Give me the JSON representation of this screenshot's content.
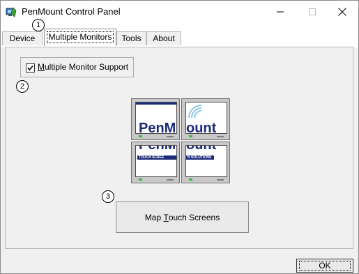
{
  "window": {
    "title": "PenMount Control Panel"
  },
  "tabs": [
    {
      "label": "Device",
      "selected": false
    },
    {
      "label": "Multiple Monitors",
      "selected": true
    },
    {
      "label": "Tools",
      "selected": false
    },
    {
      "label": "About",
      "selected": false
    }
  ],
  "callouts": {
    "one": "1",
    "two": "2",
    "three": "3"
  },
  "multi_monitor": {
    "checkbox_underlined_char": "M",
    "checkbox_label_rest": "ultiple Monitor Support",
    "checked": true
  },
  "logo": {
    "top_left": "PenM",
    "top_right": "ount",
    "bottom_left_strip": "TOUCH SCREE",
    "bottom_right_strip": "N SOLUTIONS",
    "bottom_left": "PenM",
    "bottom_right": "ount"
  },
  "map_button": {
    "prefix": "Map ",
    "underlined_char": "T",
    "suffix": "ouch Screens"
  },
  "ok_button": {
    "label": "OK"
  },
  "colors": {
    "logo_blue": "#1c2a7a",
    "led_green": "#23c23b",
    "panel_bg": "#f0f0f0"
  }
}
